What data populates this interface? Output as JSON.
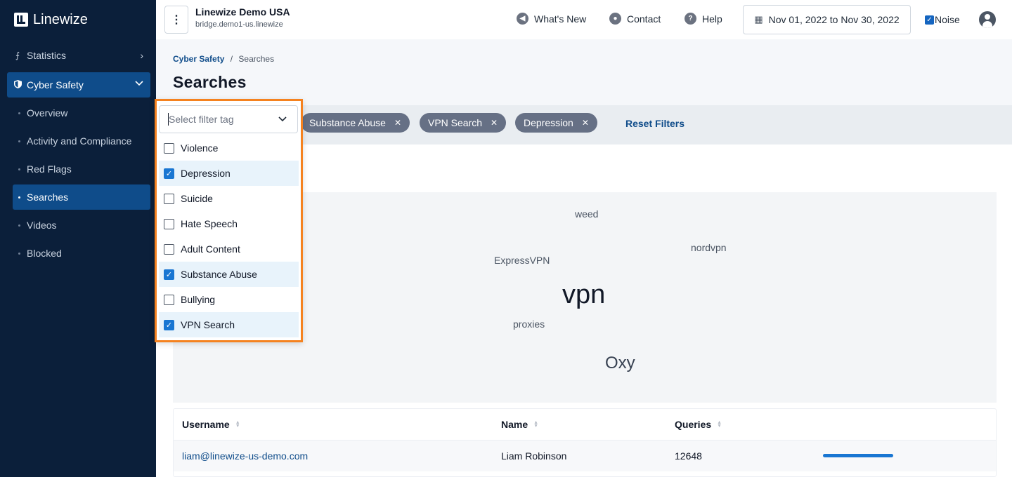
{
  "brand": {
    "name": "Linewize"
  },
  "sidebar": {
    "items": [
      {
        "label": "Statistics",
        "icon": "chart-icon",
        "expanded": false
      },
      {
        "label": "Cyber Safety",
        "icon": "shield-icon",
        "expanded": true
      }
    ],
    "sub_items": [
      {
        "label": "Overview"
      },
      {
        "label": "Activity and Compliance"
      },
      {
        "label": "Red Flags"
      },
      {
        "label": "Searches",
        "active": true
      },
      {
        "label": "Videos"
      },
      {
        "label": "Blocked"
      }
    ]
  },
  "header": {
    "org_name": "Linewize Demo USA",
    "org_host": "bridge.demo1-us.linewize",
    "whats_new": "What's New",
    "contact": "Contact",
    "help": "Help",
    "date_range": "Nov 01, 2022 to Nov 30, 2022",
    "noise_label": "Noise",
    "noise_checked": true
  },
  "breadcrumb": {
    "parent": "Cyber Safety",
    "separator": "/",
    "current": "Searches"
  },
  "page_title": "Searches",
  "filter": {
    "placeholder": "Select filter tag",
    "chips": [
      "Substance Abuse",
      "VPN Search",
      "Depression"
    ],
    "reset_label": "Reset Filters",
    "options": [
      {
        "label": "Violence",
        "checked": false
      },
      {
        "label": "Depression",
        "checked": true
      },
      {
        "label": "Suicide",
        "checked": false
      },
      {
        "label": "Hate Speech",
        "checked": false
      },
      {
        "label": "Adult Content",
        "checked": false
      },
      {
        "label": "Substance Abuse",
        "checked": true
      },
      {
        "label": "Bullying",
        "checked": false
      },
      {
        "label": "VPN Search",
        "checked": true
      }
    ]
  },
  "word_cloud": [
    "weed",
    "nordvpn",
    "ExpressVPN",
    "vpn",
    "proxies",
    "Oxy"
  ],
  "table": {
    "headers": [
      "Username",
      "Name",
      "Queries"
    ],
    "rows": [
      {
        "username": "liam@linewize-us-demo.com",
        "name": "Liam Robinson",
        "queries": "12648",
        "bar_fraction": 1.0
      }
    ]
  },
  "colors": {
    "sidebar_bg": "#0b1f3a",
    "active_nav": "#0f4c8a",
    "accent": "#1976d2",
    "highlight_border": "#f5821f",
    "chip_bg": "#667085"
  }
}
